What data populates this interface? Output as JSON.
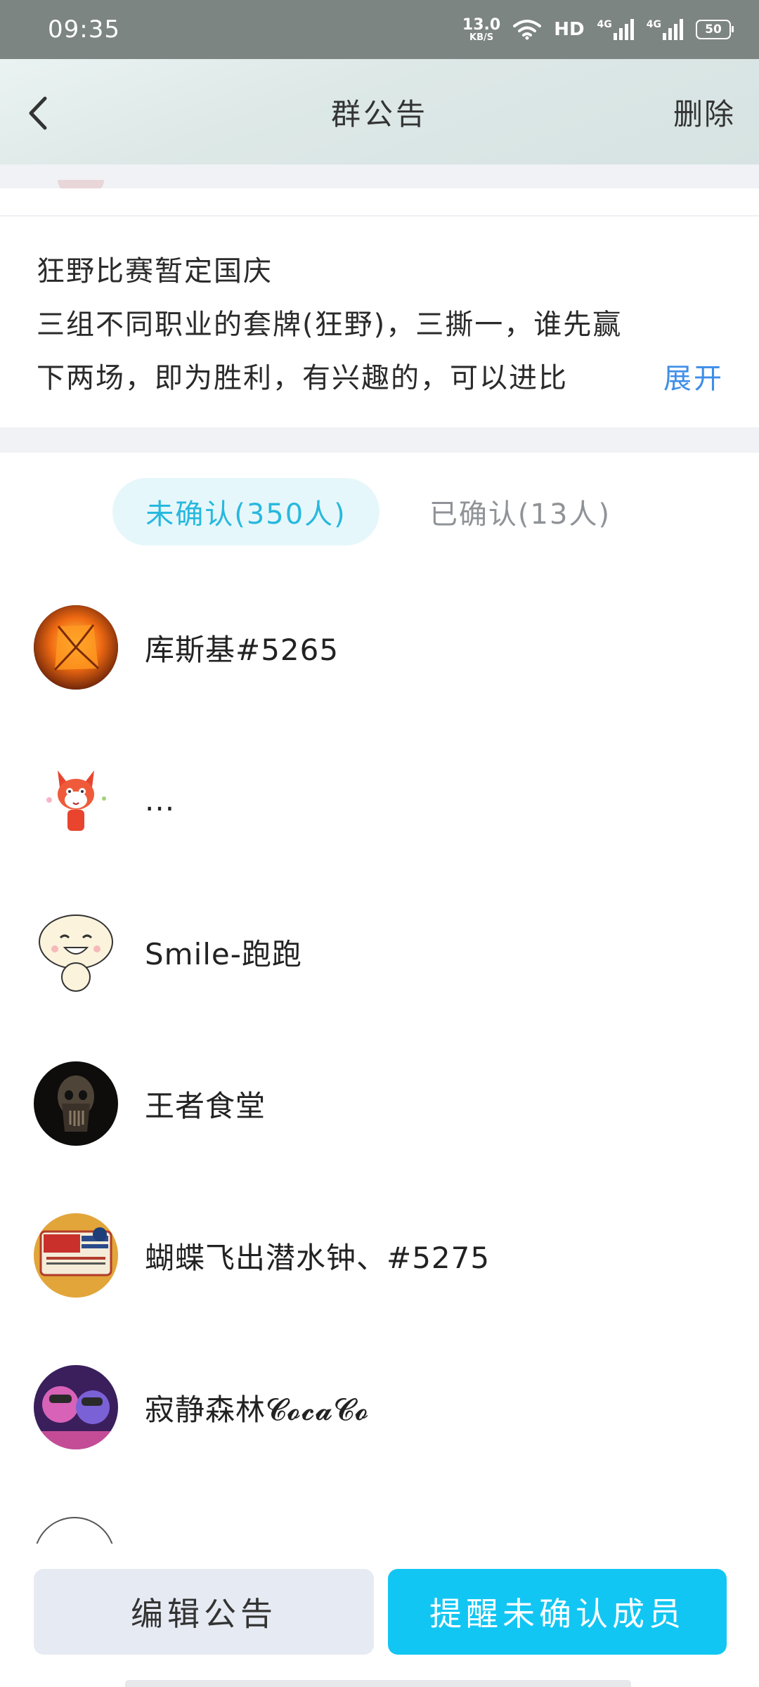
{
  "status_bar": {
    "time": "09:35",
    "net_speed_value": "13.0",
    "net_speed_unit": "KB/S",
    "hd_label": "HD",
    "signal1_label": "4G",
    "signal2_label": "4G",
    "battery": "50"
  },
  "header": {
    "back_icon": "chevron-left-icon",
    "title": "群公告",
    "delete_label": "删除"
  },
  "announcement": {
    "lines": [
      "狂野比赛暂定国庆",
      "三组不同职业的套牌(狂野)，三撕一，谁先赢",
      "下两场，即为胜利，有兴趣的，可以进比"
    ],
    "expand_label": "展开"
  },
  "tabs": {
    "unconfirmed": "未确认(350人)",
    "confirmed": "已确认(13人)"
  },
  "members": [
    {
      "name": "库斯基#5265"
    },
    {
      "name": "..."
    },
    {
      "name": "Smile-跑跑"
    },
    {
      "name": "王者食堂"
    },
    {
      "name": "蝴蝶飞出潜水钟、#5275"
    },
    {
      "name": "寂静森林𝓒𝓸𝓬𝓪𝓒𝓸"
    }
  ],
  "actions": {
    "edit_label": "编辑公告",
    "remind_label": "提醒未确认成员"
  },
  "colors": {
    "accent": "#12c6f3",
    "tab_active_text": "#27b8de",
    "expand_link": "#3f8ee8"
  }
}
